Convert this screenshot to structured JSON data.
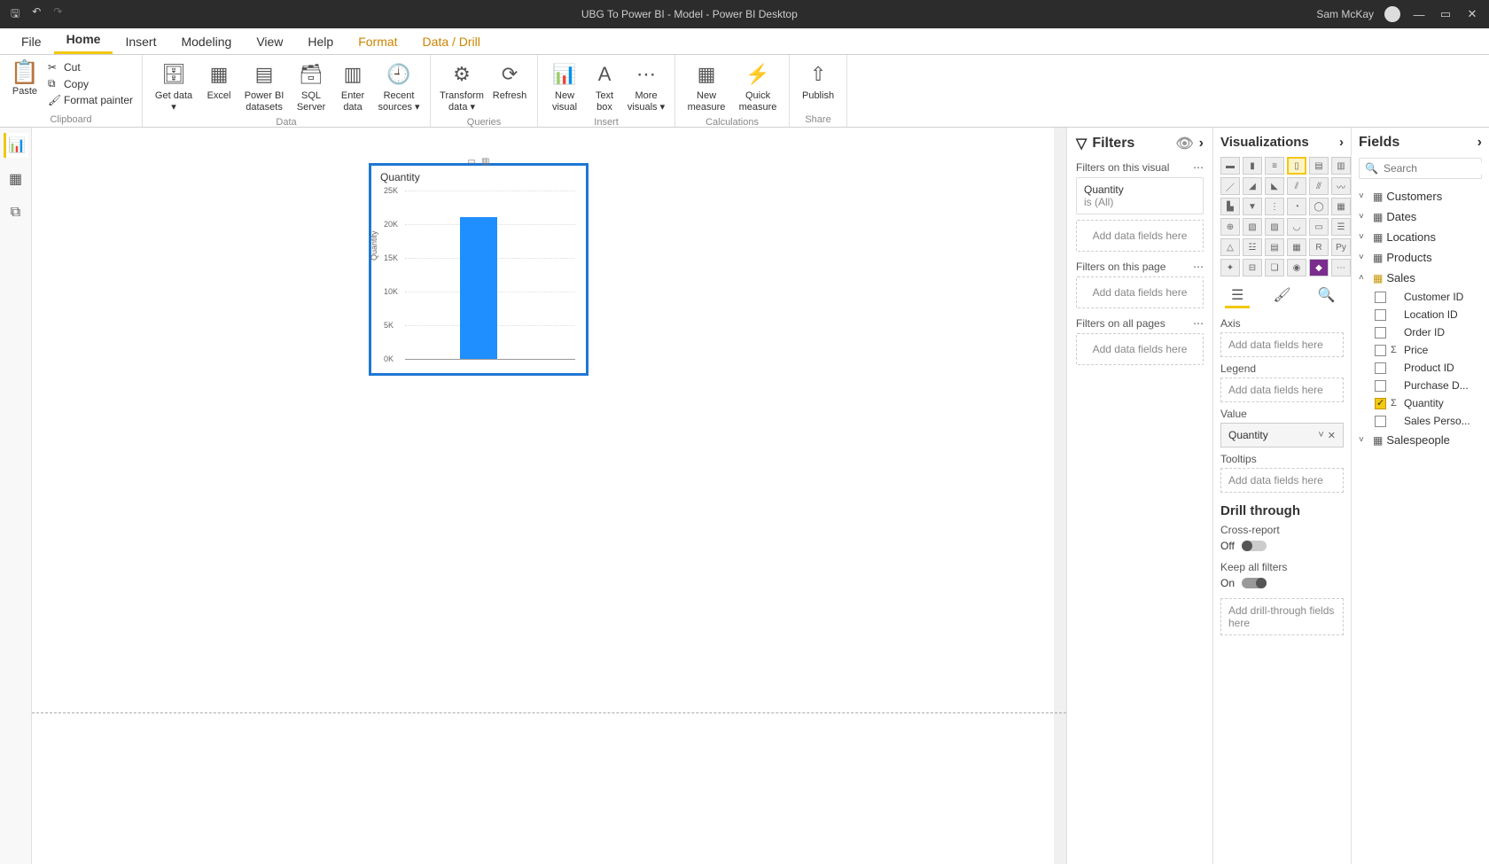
{
  "titlebar": {
    "title": "UBG To Power BI - Model - Power BI Desktop",
    "user": "Sam McKay"
  },
  "menu": {
    "tabs": [
      "File",
      "Home",
      "Insert",
      "Modeling",
      "View",
      "Help",
      "Format",
      "Data / Drill"
    ],
    "active": "Home"
  },
  "ribbon": {
    "clipboard": {
      "paste": "Paste",
      "cut": "Cut",
      "copy": "Copy",
      "format_painter": "Format painter",
      "group": "Clipboard"
    },
    "data": {
      "get_data": "Get data",
      "excel": "Excel",
      "pbi_datasets": "Power BI datasets",
      "sql": "SQL Server",
      "enter": "Enter data",
      "recent": "Recent sources",
      "group": "Data"
    },
    "queries": {
      "transform": "Transform data",
      "refresh": "Refresh",
      "group": "Queries"
    },
    "insert": {
      "new_visual": "New visual",
      "text_box": "Text box",
      "more_visuals": "More visuals",
      "group": "Insert"
    },
    "calculations": {
      "new_measure": "New measure",
      "quick_measure": "Quick measure",
      "group": "Calculations"
    },
    "share": {
      "publish": "Publish",
      "group": "Share"
    }
  },
  "chart_data": {
    "type": "bar",
    "title": "Quantity",
    "ylabel": "Quantity",
    "yticks": [
      "25K",
      "20K",
      "15K",
      "10K",
      "5K",
      "0K"
    ],
    "categories": [
      ""
    ],
    "values": [
      21000
    ],
    "ylim": [
      0,
      25000
    ]
  },
  "filters": {
    "title": "Filters",
    "sections": {
      "visual": "Filters on this visual",
      "page": "Filters on this page",
      "all": "Filters on all pages"
    },
    "card": {
      "name": "Quantity",
      "state": "is (All)"
    },
    "placeholder": "Add data fields here"
  },
  "viz": {
    "title": "Visualizations",
    "wells": {
      "axis": "Axis",
      "legend": "Legend",
      "value": "Value",
      "tooltips": "Tooltips",
      "placeholder": "Add data fields here",
      "value_item": "Quantity"
    },
    "drill": {
      "title": "Drill through",
      "cross": "Cross-report",
      "off": "Off",
      "keep": "Keep all filters",
      "on": "On",
      "placeholder": "Add drill-through fields here"
    }
  },
  "fields": {
    "title": "Fields",
    "search": "Search",
    "tables": [
      "Customers",
      "Dates",
      "Locations",
      "Products",
      "Sales",
      "Salespeople"
    ],
    "sales_fields": [
      {
        "name": "Customer ID",
        "sigma": false,
        "checked": false
      },
      {
        "name": "Location ID",
        "sigma": false,
        "checked": false
      },
      {
        "name": "Order ID",
        "sigma": false,
        "checked": false
      },
      {
        "name": "Price",
        "sigma": true,
        "checked": false
      },
      {
        "name": "Product ID",
        "sigma": false,
        "checked": false
      },
      {
        "name": "Purchase D...",
        "sigma": false,
        "checked": false
      },
      {
        "name": "Quantity",
        "sigma": true,
        "checked": true
      },
      {
        "name": "Sales Perso...",
        "sigma": false,
        "checked": false
      }
    ]
  }
}
